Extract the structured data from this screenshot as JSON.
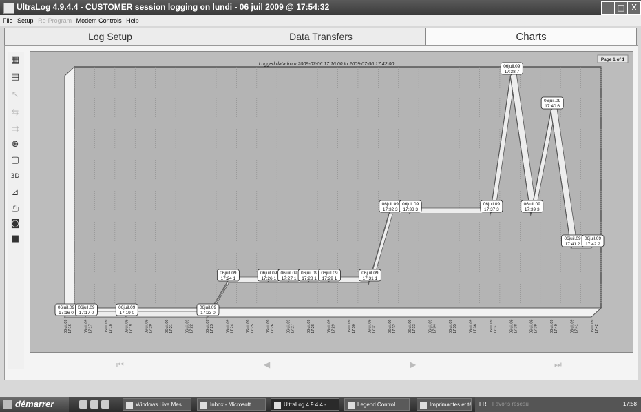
{
  "window": {
    "title": "UltraLog 4.9.4.4 - CUSTOMER session logging on lundi - 06 juil 2009 @ 17:54:32",
    "minimize": "_",
    "maximize": "□",
    "close": "X"
  },
  "menu": [
    "File",
    "Setup",
    "Re-Program",
    "Modem Controls",
    "Help"
  ],
  "tabs": [
    "Log Setup",
    "Data Transfers",
    "Charts"
  ],
  "toolbar_icons": [
    "grid-icon",
    "calendar-icon",
    "pointer-icon",
    "swap-icon",
    "arrows-icon",
    "zoom-icon",
    "page-icon",
    "3d-icon",
    "chart-icon",
    "print-icon",
    "camera-icon",
    "save-icon"
  ],
  "toolbar_3d_label": "3D",
  "chart": {
    "page_label": "Page 1 of 1",
    "zero_label": "0"
  },
  "chart_data": {
    "type": "line",
    "title": "Logged data from 2009-07-06 17:16:00 to 2009-07-06 17:42:00",
    "x_ticks": [
      "17:16",
      "17:17",
      "17:18",
      "17:19",
      "17:20",
      "17:21",
      "17:22",
      "17:23",
      "17:24",
      "17:25",
      "17:26",
      "17:27",
      "17:28",
      "17:29",
      "17:30",
      "17:31",
      "17:32",
      "17:33",
      "17:34",
      "17:35",
      "17:36",
      "17:37",
      "17:38",
      "17:39",
      "17:40",
      "17:41",
      "17:42"
    ],
    "x_tick_date": "06juil.09",
    "series": [
      {
        "x": [
          "17:16",
          "17:17",
          "17:19",
          "17:23",
          "17:24",
          "17:26",
          "17:27",
          "17:28",
          "17:29",
          "17:31",
          "17:32",
          "17:33",
          "17:37",
          "17:38",
          "17:39",
          "17:40",
          "17:41",
          "17:42"
        ],
        "y": [
          0,
          0,
          0,
          0,
          1,
          1,
          1,
          1,
          1,
          1,
          3,
          3,
          3,
          7,
          3,
          6,
          2,
          2
        ],
        "labels": [
          "06juil.09\n17:16 0",
          "06juil.09\n17:17 0",
          "06juil.09\n17:19 0",
          "06juil.09\n17:23 0",
          "06juil.09\n17:24 1",
          "06juil.09\n17:26 1",
          "06juil.09\n17:27 1",
          "06juil.09\n17:28 1",
          "06juil.09\n17:29 1",
          "06juil.09\n17:31 1",
          "06juil.09\n17:32 3",
          "06juil.09\n17:33 3",
          "06juil.09\n17:37 3",
          "06juil.09\n17:38 7",
          "06juil.09\n17:39 3",
          "06juil.09\n17:40 6",
          "06juil.09\n17:41 2",
          "06juil.09\n17:42 2"
        ]
      }
    ],
    "ylim": [
      0,
      7
    ],
    "grid": true
  },
  "nav": [
    "⏮",
    "◀",
    "▶",
    "⏭"
  ],
  "taskbar": {
    "start": "démarrer",
    "tasks": [
      "Windows Live Mes...",
      "Inbox - Microsoft ...",
      "UltraLog 4.9.4.4 - ...",
      "Legend Control",
      "Imprimantes et tél..."
    ],
    "tray_lang": "FR",
    "tray_text": "Favoris réseau",
    "clock": "17:58"
  }
}
